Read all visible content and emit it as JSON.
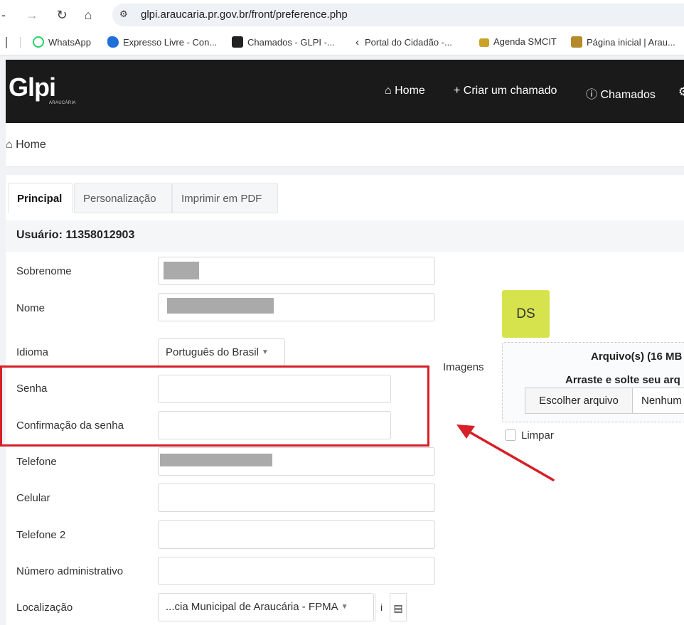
{
  "browser": {
    "url": "glpi.araucaria.pr.gov.br/front/preference.php",
    "bookmarks": [
      {
        "label": "WhatsApp",
        "icon": "whatsapp-icon",
        "color": "#25d366"
      },
      {
        "label": "Expresso Livre - Con...",
        "icon": "expresso-icon",
        "color": "#1e6fd9"
      },
      {
        "label": "Chamados - GLPI -...",
        "icon": "glpi-icon",
        "color": "#222222"
      },
      {
        "label": "Portal do Cidadão -...",
        "icon": "portal-icon",
        "color": "#333333"
      },
      {
        "label": "Agenda SMCIT",
        "icon": "agenda-icon",
        "color": "#c9a227"
      },
      {
        "label": "Página inicial | Arau...",
        "icon": "araucaria-icon",
        "color": "#b58a2a"
      }
    ]
  },
  "header": {
    "logo": "Glpi",
    "logo_sub": "ARAUCÁRIA",
    "nav": [
      {
        "label": "Home",
        "icon": "home-icon"
      },
      {
        "label": "Criar um chamado",
        "icon": "plus-icon"
      },
      {
        "label": "Chamados",
        "icon": "alert-circle-icon"
      }
    ]
  },
  "breadcrumb": {
    "label": "Home"
  },
  "tabs": [
    {
      "label": "Principal",
      "active": true
    },
    {
      "label": "Personalização",
      "active": false
    },
    {
      "label": "Imprimir em PDF",
      "active": false
    }
  ],
  "user": {
    "title": "Usuário: 11358012903"
  },
  "form": {
    "sobrenome": "Sobrenome",
    "nome": "Nome",
    "idioma": "Idioma",
    "idioma_value": "Português do Brasil",
    "senha": "Senha",
    "confirmacao": "Confirmação da senha",
    "telefone": "Telefone",
    "celular": "Celular",
    "telefone2": "Telefone 2",
    "numero_admin": "Número administrativo",
    "localizacao": "Localização",
    "localizacao_value": "...cia Municipal de Araucária - FPMA"
  },
  "images": {
    "label": "Imagens",
    "avatar_initials": "DS",
    "upload_title": "Arquivo(s) (16 MB",
    "upload_hint": "Arraste e solte seu arq",
    "choose_button": "Escolher arquivo",
    "no_file": "Nenhum",
    "clear_label": "Limpar"
  },
  "colors": {
    "accent_red": "#d61f26",
    "avatar_bg": "#d6e34d",
    "header_bg": "#1a1a1a"
  }
}
